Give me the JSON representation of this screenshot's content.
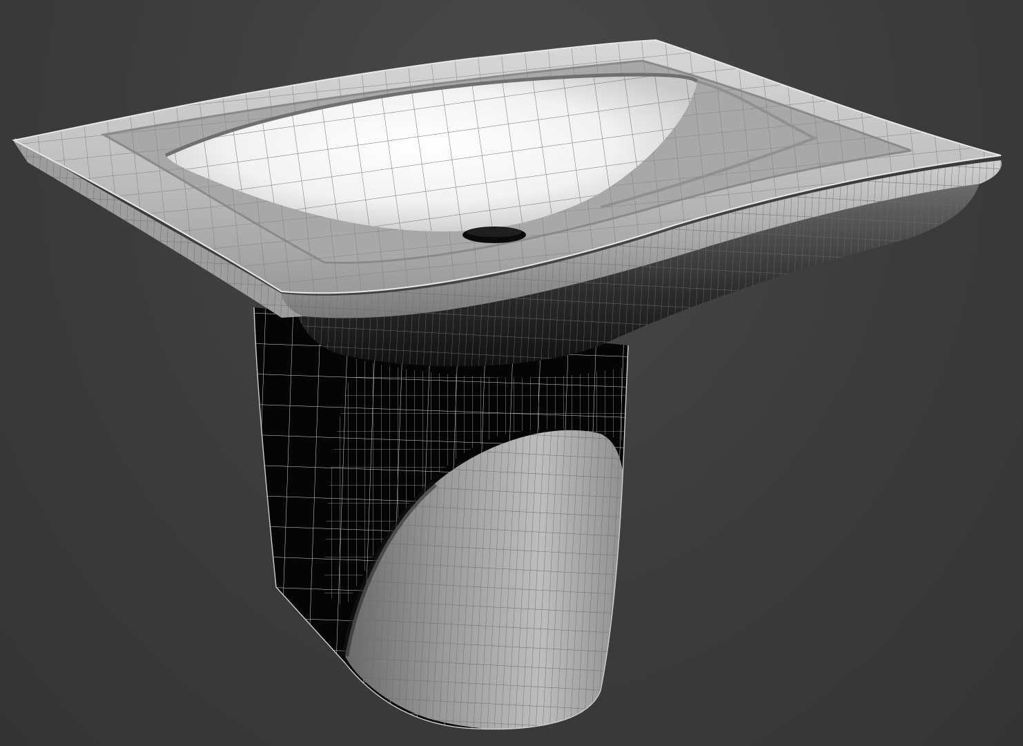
{
  "viewport": {
    "shading_mode": "shaded-with-wireframe",
    "background_color": "#3b3b3b",
    "wire_color_light": "#8a8a8a",
    "wire_color_dark": "#e6e6e6"
  },
  "model": {
    "object": "washbasin-with-semi-pedestal",
    "parts": [
      "basin",
      "bowl",
      "drain",
      "semi-pedestal"
    ]
  }
}
